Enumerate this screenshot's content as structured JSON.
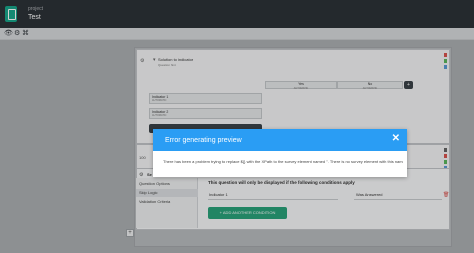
{
  "header": {
    "project_label": "project",
    "project_name": "Test"
  },
  "toolbar": {
    "icons": [
      "eye-icon",
      "settings-icon",
      "tree-icon"
    ]
  },
  "questions": [
    {
      "title": "Solution to indicator",
      "subtitle": "Question hint",
      "columns": [
        {
          "label": "Yes",
          "sub": "AUTOMATIC"
        },
        {
          "label": "No",
          "sub": "AUTOMATIC"
        }
      ],
      "rows": [
        {
          "label": "Indicator 1",
          "sub": "AUTOMATIC"
        },
        {
          "label": "Indicator 2",
          "sub": "AUTOMATIC"
        }
      ]
    },
    {
      "number": "100"
    }
  ],
  "settings_panel": {
    "title": "Se",
    "tabs": [
      "Question Options",
      "Skip Logic",
      "Validation Criteria"
    ],
    "active_tab": "Skip Logic",
    "condition_title": "This question will only be displayed if the following conditions apply",
    "condition": {
      "question": "Indicator 1",
      "operator": "Was Answered"
    },
    "add_condition_label": "+ ADD ANOTHER CONDITION"
  },
  "modal": {
    "title": "Error generating preview",
    "message": "There has been a problem trying to replace ${} with the XPath to the survey element named ''. There is no survey element with this name."
  },
  "colors": {
    "accent": "#2a9df4",
    "success": "#2aa37a",
    "topbar": "#2d3237",
    "danger": "#d9534f"
  }
}
